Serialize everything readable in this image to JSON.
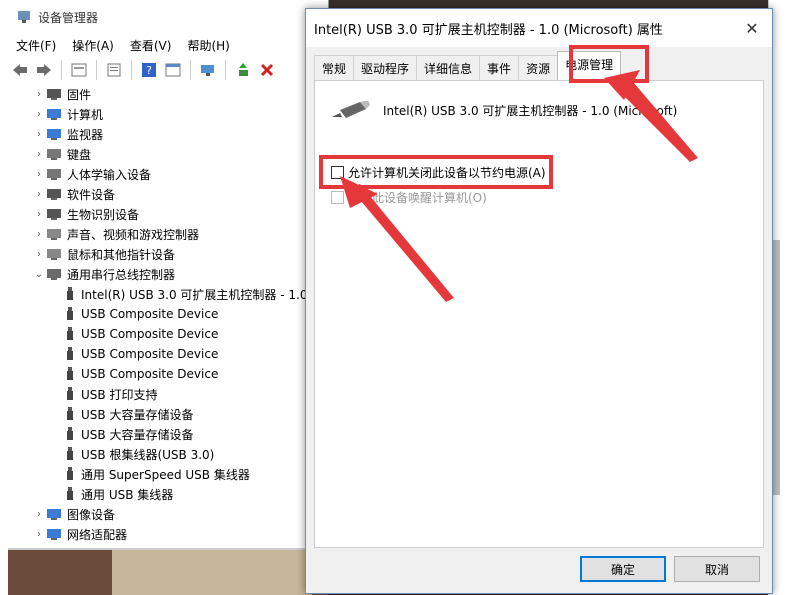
{
  "device_manager": {
    "title": "设备管理器",
    "menu": [
      "文件(F)",
      "操作(A)",
      "查看(V)",
      "帮助(H)"
    ],
    "tree": [
      {
        "label": "固件",
        "expanded": false
      },
      {
        "label": "计算机",
        "expanded": false
      },
      {
        "label": "监视器",
        "expanded": false
      },
      {
        "label": "键盘",
        "expanded": false
      },
      {
        "label": "人体学输入设备",
        "expanded": false
      },
      {
        "label": "软件设备",
        "expanded": false
      },
      {
        "label": "生物识别设备",
        "expanded": false
      },
      {
        "label": "声音、视频和游戏控制器",
        "expanded": false
      },
      {
        "label": "鼠标和其他指针设备",
        "expanded": false
      },
      {
        "label": "通用串行总线控制器",
        "expanded": true
      },
      {
        "label": "Intel(R) USB 3.0 可扩展主机控制器 - 1.0",
        "child": true
      },
      {
        "label": "USB Composite Device",
        "child": true
      },
      {
        "label": "USB Composite Device",
        "child": true
      },
      {
        "label": "USB Composite Device",
        "child": true
      },
      {
        "label": "USB Composite Device",
        "child": true
      },
      {
        "label": "USB 打印支持",
        "child": true
      },
      {
        "label": "USB 大容量存储设备",
        "child": true
      },
      {
        "label": "USB 大容量存储设备",
        "child": true
      },
      {
        "label": "USB 根集线器(USB 3.0)",
        "child": true
      },
      {
        "label": "通用 SuperSpeed USB 集线器",
        "child": true
      },
      {
        "label": "通用 USB 集线器",
        "child": true
      },
      {
        "label": "图像设备",
        "expanded": false
      },
      {
        "label": "网络适配器",
        "expanded": false
      }
    ]
  },
  "dialog": {
    "title": "Intel(R) USB 3.0 可扩展主机控制器 - 1.0 (Microsoft) 属性",
    "close": "✕",
    "tabs": [
      "常规",
      "驱动程序",
      "详细信息",
      "事件",
      "资源",
      "电源管理"
    ],
    "device_name": "Intel(R) USB 3.0 可扩展主机控制器 - 1.0 (Microsoft)",
    "option1": "允许计算机关闭此设备以节约电源(A)",
    "option2": "允许此设备唤醒计算机(O)",
    "ok": "确定",
    "cancel": "取消"
  },
  "colors": {
    "highlight": "#e5383b",
    "accent": "#0078d7"
  }
}
